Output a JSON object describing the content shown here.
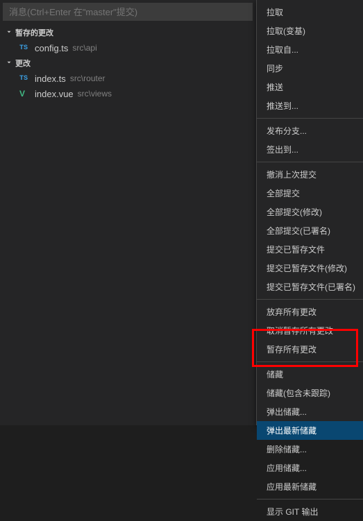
{
  "commit_input": {
    "placeholder": "消息(Ctrl+Enter 在\"master\"提交)"
  },
  "sections": {
    "staged": {
      "label": "暂存的更改",
      "items": [
        {
          "icon": "TS",
          "name": "config.ts",
          "path": "src\\api"
        }
      ]
    },
    "changes": {
      "label": "更改",
      "items": [
        {
          "icon": "TS",
          "name": "index.ts",
          "path": "src\\router"
        },
        {
          "icon": "V",
          "name": "index.vue",
          "path": "src\\views"
        }
      ]
    }
  },
  "menu": {
    "group1": [
      "拉取",
      "拉取(变基)",
      "拉取自...",
      "同步",
      "推送",
      "推送到..."
    ],
    "group2": [
      "发布分支...",
      "签出到..."
    ],
    "group3": [
      "撤消上次提交",
      "全部提交",
      "全部提交(修改)",
      "全部提交(已署名)",
      "提交已暂存文件",
      "提交已暂存文件(修改)",
      "提交已暂存文件(已署名)"
    ],
    "group4": [
      "放弃所有更改",
      "取消暂存所有更改",
      "暂存所有更改"
    ],
    "group5": [
      "储藏",
      "储藏(包含未跟踪)",
      "弹出储藏...",
      "弹出最新储藏",
      "删除储藏...",
      "应用储藏...",
      "应用最新储藏"
    ],
    "group6": [
      "显示 GIT 输出"
    ]
  },
  "highlighted_item": "弹出最新储藏"
}
